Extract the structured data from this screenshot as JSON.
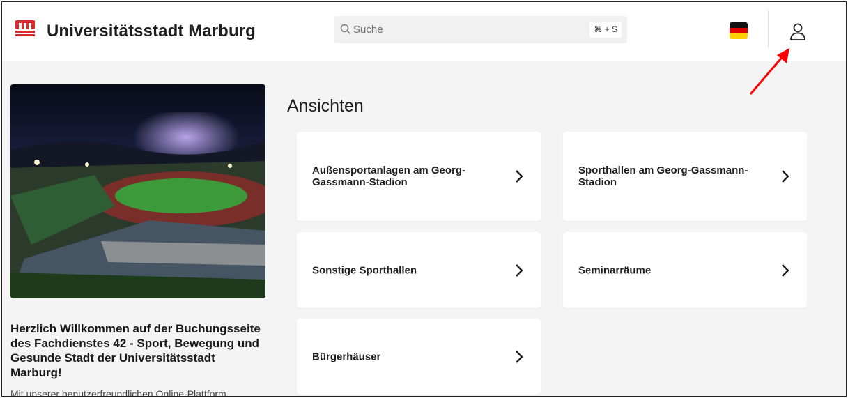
{
  "header": {
    "title": "Universitätsstadt Marburg",
    "brand_color": "#d92b2b",
    "search": {
      "placeholder": "Suche",
      "shortcut": "⌘ + S",
      "icon": "search-icon"
    },
    "language_flag": "germany-flag-icon",
    "user_icon": "user-icon"
  },
  "main": {
    "section_title": "Ansichten",
    "cards": [
      {
        "label": "Außensportanlagen am Georg-Gassmann-Stadion"
      },
      {
        "label": "Sporthallen am Georg-Gassmann-Stadion"
      },
      {
        "label": "Sonstige Sporthallen"
      },
      {
        "label": "Seminarräume"
      },
      {
        "label": "Bürgerhäuser"
      }
    ]
  },
  "sidebar": {
    "welcome_title": "Herzlich Willkommen auf der Buchungsseite des Fachdienstes 42 - Sport, Bewegung und Gesunde Stadt der Universitätsstadt Marburg!",
    "welcome_text": "Mit unserer benutzerfreundlichen Online-Plattform"
  },
  "annotation": {
    "arrow_color": "#ff0000"
  }
}
